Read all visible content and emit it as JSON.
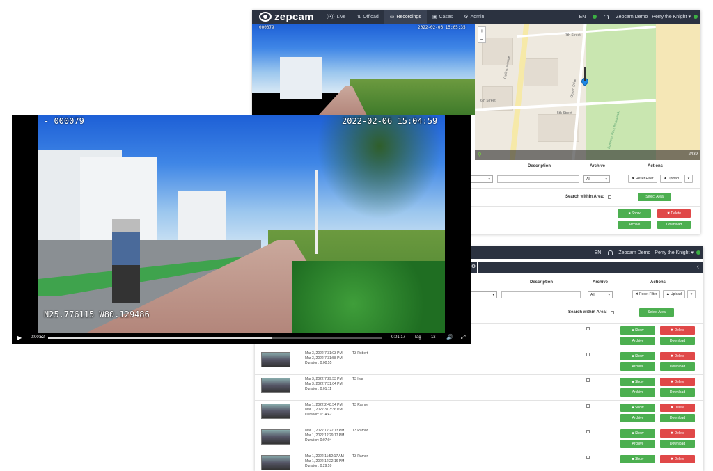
{
  "app": {
    "logo": "zepcam",
    "nav": [
      {
        "label": "Live",
        "icon": "live-icon"
      },
      {
        "label": "Offload",
        "icon": "offload-icon"
      },
      {
        "label": "Recordings",
        "icon": "recordings-icon",
        "active": true
      },
      {
        "label": "Cases",
        "icon": "cases-icon"
      },
      {
        "label": "Admin",
        "icon": "gear-icon"
      }
    ],
    "lang": "EN",
    "org": "Zepcam Demo",
    "user": "Perry the Knight"
  },
  "small_video": {
    "id": "000079",
    "timestamp": "2022-02-06 15:05:35"
  },
  "map": {
    "zoom_in": "+",
    "zoom_out": "−",
    "counter": "2439",
    "street_labels": [
      "6th Street",
      "Collins Avenue",
      "Ocean Drive",
      "7th Street",
      "5th Street",
      "Lummus Park Boardwalk"
    ]
  },
  "filters": {
    "columns": {
      "description": "Description",
      "archive": "Archive",
      "actions": "Actions"
    },
    "archive_select": "All",
    "reset_label": "Reset Filter",
    "upload_label": "Upload",
    "search_area_label": "Search within Area:",
    "select_area_label": "Select Area"
  },
  "actions": {
    "show": "Show",
    "delete": "Delete",
    "archive": "Archive",
    "download": "Download"
  },
  "recordings": [
    {
      "start": "",
      "end": "",
      "duration": "",
      "user": ""
    },
    {
      "start": "Mar 3, 2022 7:31:03 PM",
      "end": "Mar 3, 2022 7:31:58 PM",
      "duration": "Duration: 0:00:55",
      "user": "T3 Robert"
    },
    {
      "start": "Mar 3, 2022 7:29:53 PM",
      "end": "Mar 3, 2022 7:31:04 PM",
      "duration": "Duration: 0:01:11",
      "user": "T3 Ivar"
    },
    {
      "start": "Mar 1, 2022 2:48:54 PM",
      "end": "Mar 1, 2022 3:03:36 PM",
      "duration": "Duration: 0:14:42",
      "user": "T3 Ramon"
    },
    {
      "start": "Mar 1, 2022 12:22:13 PM",
      "end": "Mar 1, 2022 12:29:17 PM",
      "duration": "Duration: 0:07:04",
      "user": "T3 Ramon"
    },
    {
      "start": "Mar 1, 2022 11:52:17 AM",
      "end": "Mar 1, 2022 12:22:16 PM",
      "duration": "Duration: 0:29:59",
      "user": "T3 Ramon"
    }
  ],
  "player": {
    "id": "- 000079",
    "timestamp": "2022-02-06 15:04:59",
    "gps": "N25.776115 W80.129486",
    "current_time": "0:00:52",
    "total_time": "0:01:17",
    "tag_label": "Tag",
    "speed_label": "1x",
    "progress": 0.67
  }
}
